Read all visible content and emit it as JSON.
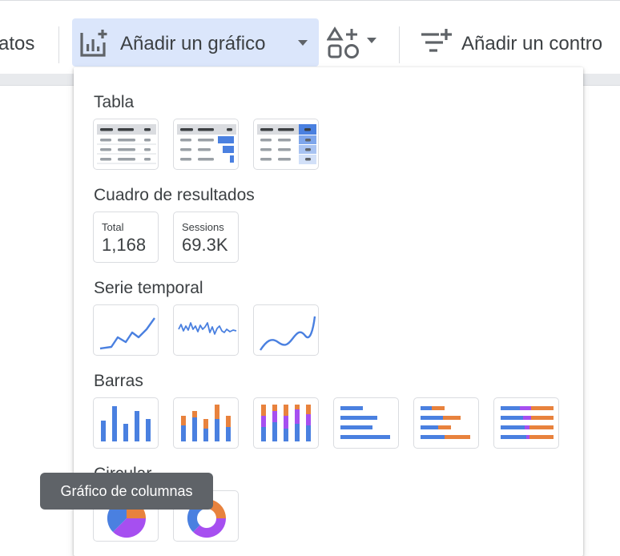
{
  "toolbar": {
    "left_partial_label": "atos",
    "add_chart_label": "Añadir un gráfico",
    "add_control_label": "Añadir un contro",
    "add_chart_icon": "add-chart-icon",
    "add_component_icon": "shapes-plus-icon",
    "add_control_icon": "filter-plus-icon"
  },
  "menu": {
    "sections": {
      "tabla": "Tabla",
      "scorecard": "Cuadro de resultados",
      "timeseries": "Serie temporal",
      "barras": "Barras",
      "circular": "Circular"
    },
    "scorecards": [
      {
        "label": "Total",
        "value": "1,168"
      },
      {
        "label": "Sessions",
        "value": "69.3K"
      }
    ]
  },
  "tooltip": "Gráfico de columnas",
  "colors": {
    "blue": "#4a80e0",
    "orange": "#e8823d",
    "purple": "#a64ff0",
    "header_gray": "#dadce0",
    "line_gray": "#9aa0a6",
    "active_button_bg": "#dbe6fb",
    "tooltip_bg": "#5f6368"
  }
}
